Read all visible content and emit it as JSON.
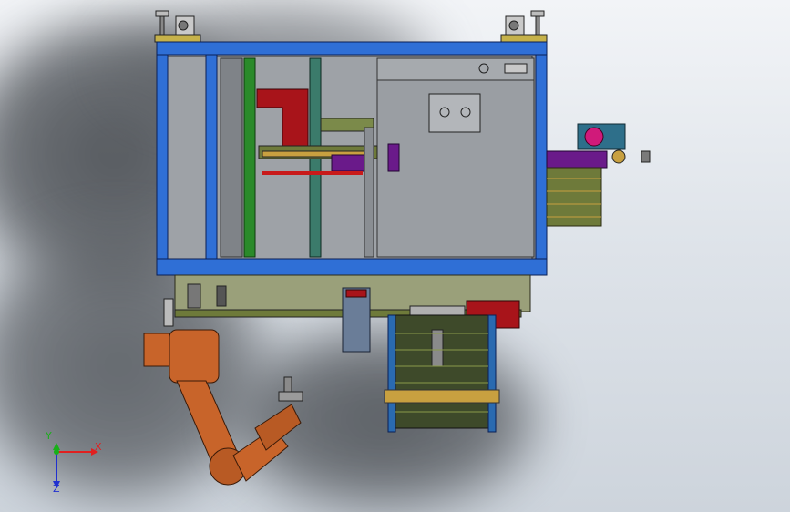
{
  "view": {
    "background_top": "#f2f4f7",
    "background_bottom": "#cdd4dc"
  },
  "triad": {
    "x_label": "X",
    "y_label": "Y",
    "z_label": "Z",
    "x_color": "#e02020",
    "y_color": "#18b018",
    "z_color": "#2030d0"
  },
  "colors": {
    "frame_blue": "#2f6fd6",
    "panel_gray": "#9a9ea3",
    "robot_orange": "#c8642a",
    "accent_red": "#a8141a",
    "green_bar": "#2a8a2a",
    "purple": "#6a1a8a",
    "magenta": "#d01a7a",
    "olive": "#6e7a3a"
  },
  "icons": [
    "axis-triad-icon"
  ]
}
